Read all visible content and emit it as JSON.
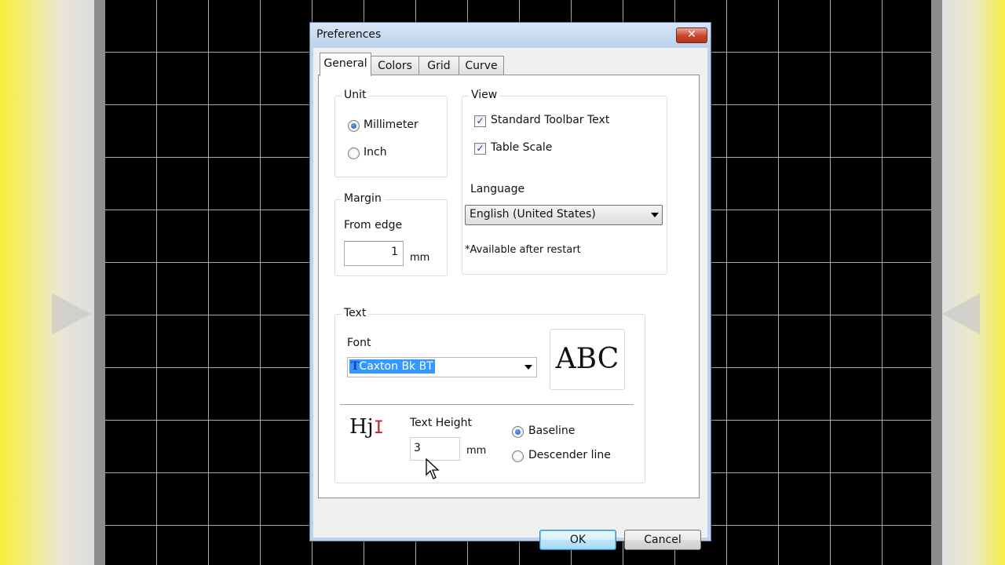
{
  "dialog": {
    "title": "Preferences",
    "close_symbol": "✕",
    "tabs": [
      {
        "label": "General",
        "active": true
      },
      {
        "label": "Colors",
        "active": false
      },
      {
        "label": "Grid",
        "active": false
      },
      {
        "label": "Curve",
        "active": false
      }
    ],
    "unit": {
      "title": "Unit",
      "options": [
        {
          "label": "Millimeter",
          "selected": true
        },
        {
          "label": "Inch",
          "selected": false
        }
      ]
    },
    "margin": {
      "title": "Margin",
      "from_edge_label": "From edge",
      "value": "1",
      "unit": "mm"
    },
    "view": {
      "title": "View",
      "checkboxes": [
        {
          "label": "Standard Toolbar Text",
          "checked": true
        },
        {
          "label": "Table Scale",
          "checked": true
        }
      ],
      "language_label": "Language",
      "language_value": "English (United States)",
      "restart_note": "*Available after restart"
    },
    "text": {
      "title": "Text",
      "font_label": "Font",
      "font_value": "Caxton Bk BT",
      "font_icon": "truetype-font-icon",
      "preview_text": "ABC",
      "height_icon_text": "Hj",
      "text_height_label": "Text Height",
      "text_height_value": "3",
      "text_height_unit": "mm",
      "alignment_options": [
        {
          "label": "Baseline",
          "selected": true
        },
        {
          "label": "Descender line",
          "selected": false
        }
      ]
    },
    "buttons": {
      "ok": "OK",
      "cancel": "Cancel"
    }
  },
  "colors": {
    "selection_highlight": "#3399ff",
    "canvas": "#000000",
    "close_button": "#c8452a"
  }
}
